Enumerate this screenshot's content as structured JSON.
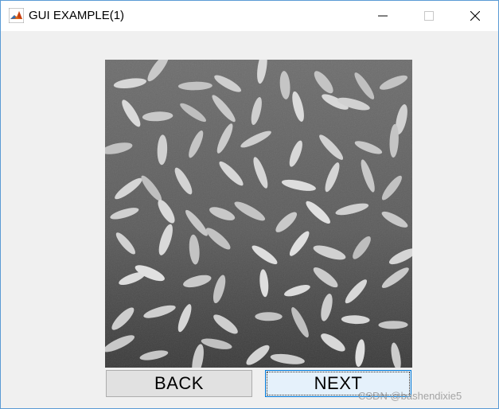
{
  "window": {
    "title": "GUI EXAMPLE(1)",
    "app_icon": "matlab-logo-icon",
    "controls": [
      "minimize-icon",
      "maximize-icon",
      "close-icon"
    ]
  },
  "image_panel": {
    "content": "grayscale photograph of rice grains on dark background"
  },
  "buttons": {
    "back_label": "BACK",
    "next_label": "NEXT"
  },
  "watermark": {
    "text": "CSDN @bashendixie5"
  },
  "colors": {
    "focus_border": "#0078d7",
    "focus_fill": "#e5f1fb",
    "button_fill": "#e1e1e1",
    "window_bg": "#f0f0f0"
  }
}
